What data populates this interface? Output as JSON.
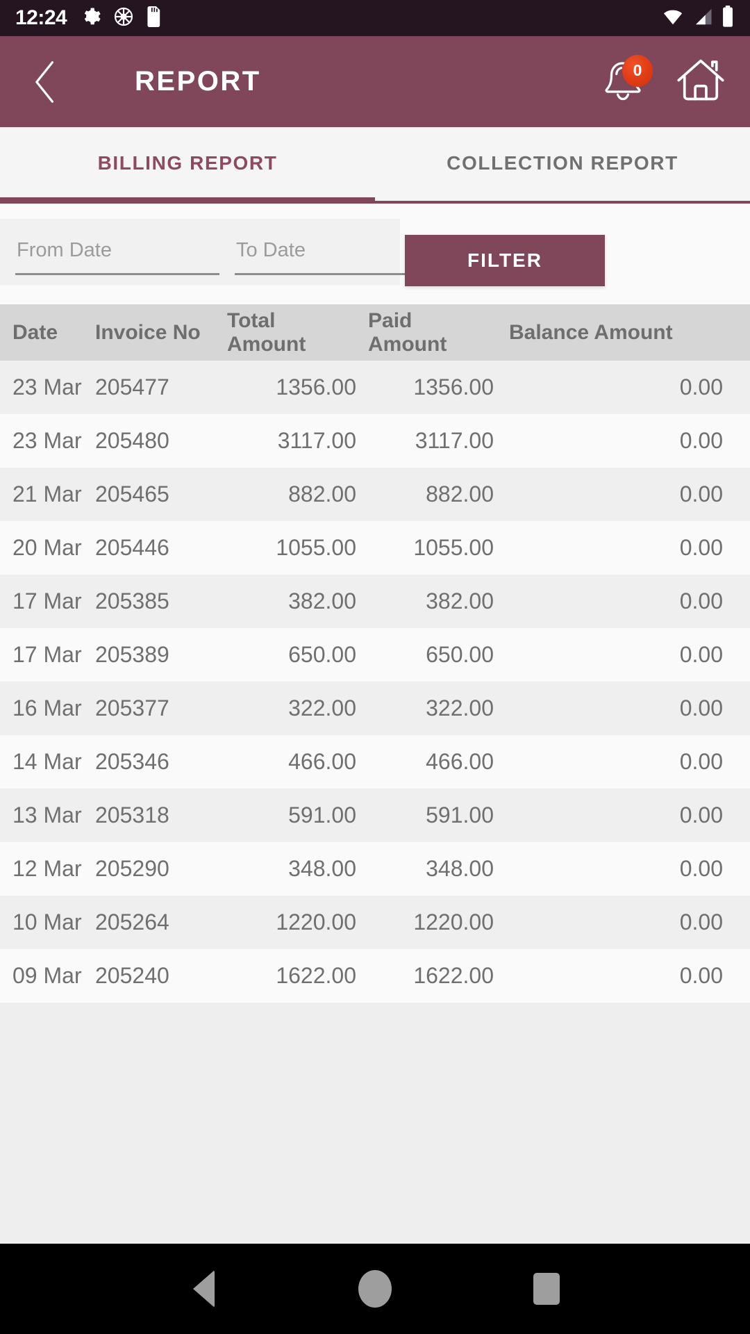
{
  "status_bar": {
    "time": "12:24",
    "left_icons": [
      "gear-icon",
      "ship-wheel-icon",
      "sd-card-icon"
    ],
    "right_icons": [
      "wifi-icon",
      "cellular-signal-icon",
      "battery-icon"
    ],
    "background": "#241520"
  },
  "app_bar": {
    "title": "REPORT",
    "back_icon": "chevron-left-icon",
    "notification_icon": "bell-icon",
    "notification_badge": "0",
    "home_icon": "home-icon",
    "background": "#80465a",
    "badge_color": "#e03b14"
  },
  "tabs": {
    "active_index": 0,
    "items": [
      {
        "label": "BILLING REPORT",
        "active": true
      },
      {
        "label": "COLLECTION REPORT",
        "active": false
      }
    ],
    "active_color": "#8d4a60",
    "inactive_color": "#707070",
    "indicator_color": "#80465a"
  },
  "filter": {
    "from_date_placeholder": "From Date",
    "from_date_value": "",
    "to_date_placeholder": "To Date",
    "to_date_value": "",
    "filter_button_label": "FILTER",
    "filter_button_color": "#80465a"
  },
  "table": {
    "headers": [
      "Date",
      "Invoice No",
      "Total Amount",
      "Paid Amount",
      "Balance Amount"
    ],
    "header_background": "#d7d6d6",
    "rows": [
      {
        "date": "23 Mar",
        "invoice_no": "205477",
        "total_amount": "1356.00",
        "paid_amount": "1356.00",
        "balance_amount": "0.00"
      },
      {
        "date": "23 Mar",
        "invoice_no": "205480",
        "total_amount": "3117.00",
        "paid_amount": "3117.00",
        "balance_amount": "0.00"
      },
      {
        "date": "21 Mar",
        "invoice_no": "205465",
        "total_amount": "882.00",
        "paid_amount": "882.00",
        "balance_amount": "0.00"
      },
      {
        "date": "20 Mar",
        "invoice_no": "205446",
        "total_amount": "1055.00",
        "paid_amount": "1055.00",
        "balance_amount": "0.00"
      },
      {
        "date": "17 Mar",
        "invoice_no": "205385",
        "total_amount": "382.00",
        "paid_amount": "382.00",
        "balance_amount": "0.00"
      },
      {
        "date": "17 Mar",
        "invoice_no": "205389",
        "total_amount": "650.00",
        "paid_amount": "650.00",
        "balance_amount": "0.00"
      },
      {
        "date": "16 Mar",
        "invoice_no": "205377",
        "total_amount": "322.00",
        "paid_amount": "322.00",
        "balance_amount": "0.00"
      },
      {
        "date": "14 Mar",
        "invoice_no": "205346",
        "total_amount": "466.00",
        "paid_amount": "466.00",
        "balance_amount": "0.00"
      },
      {
        "date": "13 Mar",
        "invoice_no": "205318",
        "total_amount": "591.00",
        "paid_amount": "591.00",
        "balance_amount": "0.00"
      },
      {
        "date": "12 Mar",
        "invoice_no": "205290",
        "total_amount": "348.00",
        "paid_amount": "348.00",
        "balance_amount": "0.00"
      },
      {
        "date": "10 Mar",
        "invoice_no": "205264",
        "total_amount": "1220.00",
        "paid_amount": "1220.00",
        "balance_amount": "0.00"
      },
      {
        "date": "09 Mar",
        "invoice_no": "205240",
        "total_amount": "1622.00",
        "paid_amount": "1622.00",
        "balance_amount": "0.00"
      }
    ]
  },
  "nav_bar": {
    "back_icon": "nav-back-triangle-icon",
    "home_icon": "nav-home-circle-icon",
    "recents_icon": "nav-recents-square-icon",
    "background": "#000000"
  }
}
